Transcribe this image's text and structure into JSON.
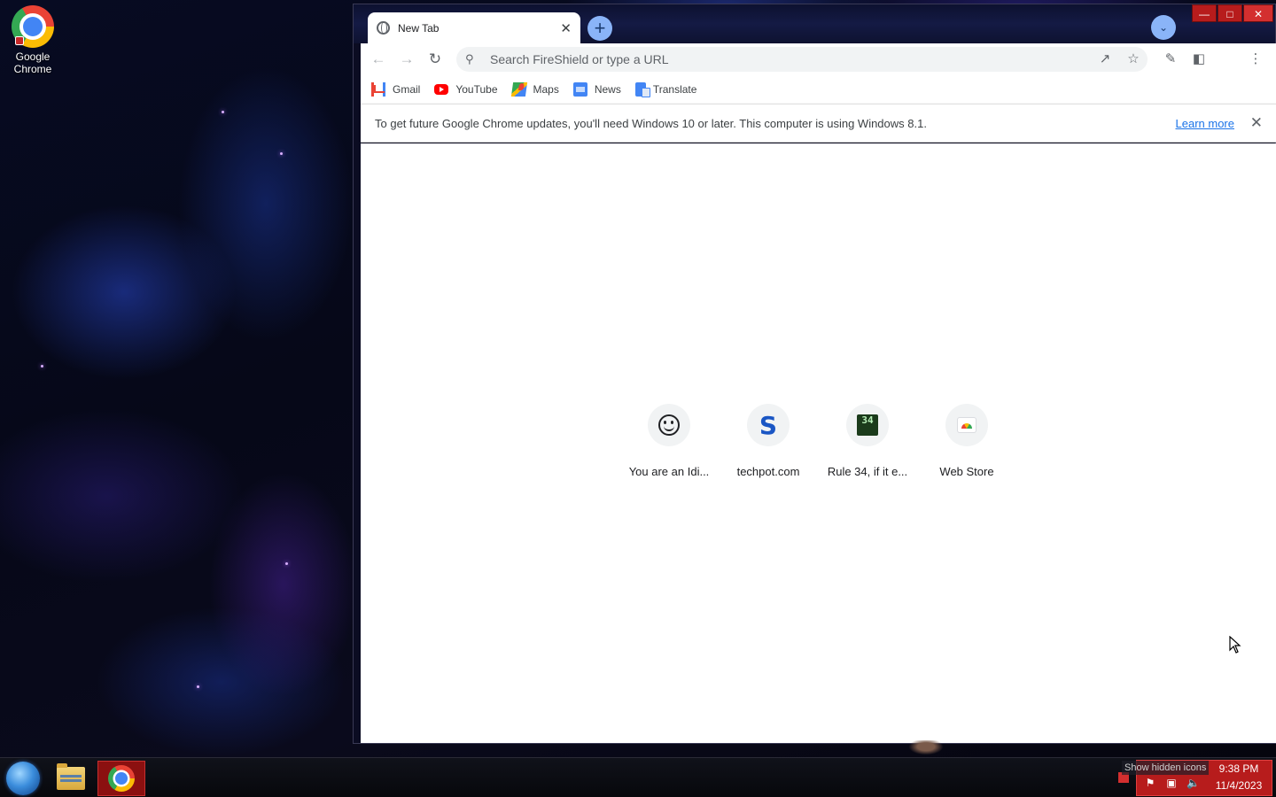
{
  "desktop": {
    "icons": [
      {
        "label": "Google Chrome",
        "icon": "chrome-icon"
      }
    ]
  },
  "window": {
    "controls": [
      "minimize-icon",
      "maximize-icon",
      "close-icon"
    ],
    "tab": {
      "title": "New Tab",
      "icon": "globe-icon"
    },
    "omnibox": {
      "placeholder": "Search FireShield or type a URL",
      "value": ""
    },
    "bookmarks": [
      {
        "label": "Gmail",
        "icon": "gmail-icon"
      },
      {
        "label": "YouTube",
        "icon": "youtube-icon"
      },
      {
        "label": "Maps",
        "icon": "maps-icon"
      },
      {
        "label": "News",
        "icon": "news-icon"
      },
      {
        "label": "Translate",
        "icon": "translate-icon"
      }
    ],
    "infobar": {
      "message": "To get future Google Chrome updates, you'll need Windows 10 or later. This computer is using Windows 8.1.",
      "link": "Learn more"
    },
    "shortcuts": [
      {
        "label": "You are an Idi...",
        "icon": "smiley-icon"
      },
      {
        "label": "techpot.com",
        "icon": "s-icon",
        "glyph": "S"
      },
      {
        "label": "Rule 34, if it e...",
        "icon": "rule34-icon",
        "glyph": "34"
      },
      {
        "label": "Web Store",
        "icon": "web-store-icon"
      }
    ]
  },
  "taskbar": {
    "tooltip": "Show hidden icons",
    "clock": {
      "time": "9:38 PM",
      "date": "11/4/2023"
    }
  },
  "colors": {
    "accent_blue": "#8ab4f8",
    "link_blue": "#1a73e8",
    "taskbar_red": "#b71c1c"
  }
}
